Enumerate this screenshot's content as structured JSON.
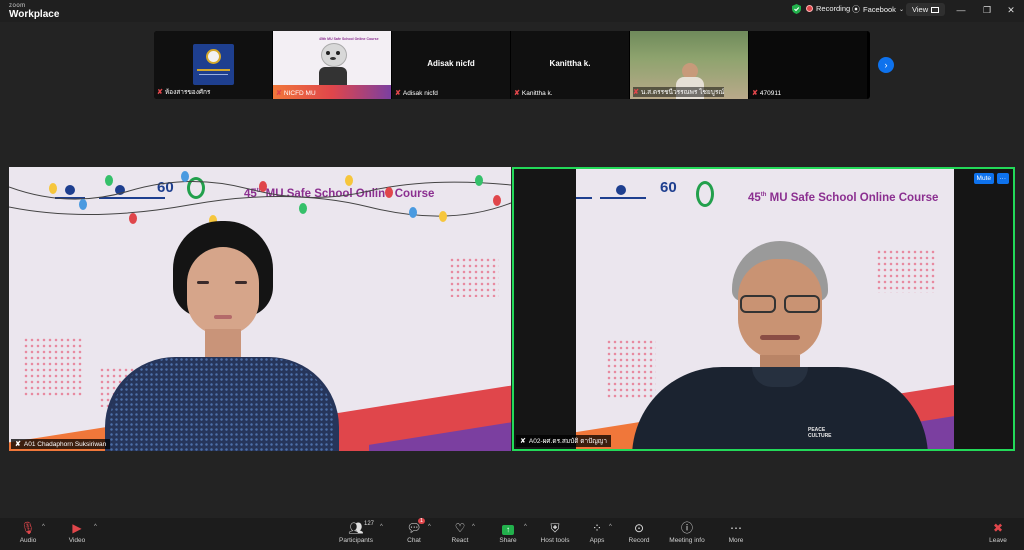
{
  "app": {
    "logo_small": "zoom",
    "logo_big": "Workplace"
  },
  "topbar": {
    "recording_label": "Recording",
    "facebook_label": "Facebook",
    "view_label": "View",
    "colors": {
      "shield": "#22b14c",
      "record_dot": "#e0464b"
    }
  },
  "thumbnails": [
    {
      "name": "ห้องสารของศักร",
      "center_text": ""
    },
    {
      "name": "NICFD MU",
      "center_text": ""
    },
    {
      "name": "Adisak nicfd",
      "center_text": "Adisak nicfd"
    },
    {
      "name": "Kanittha k.",
      "center_text": "Kanittha k."
    },
    {
      "name": "น.ส.ดรรชนีวรรณพร ไชยบูรณ์",
      "center_text": ""
    },
    {
      "name": "470911",
      "center_text": ""
    }
  ],
  "thumb_slide_title": "45th MU Safe School Online Course",
  "tiles": {
    "left": {
      "name": "A01 Chadaphorn Suksiriwan",
      "title_main": "45",
      "title_sup": "th",
      "title_rest": " MU Safe School Online Course"
    },
    "right": {
      "name": "A02-ผศ.ดร.สมบัติ ตาปัญญา",
      "title_main": "45",
      "title_sup": "th",
      "title_rest": " MU Safe School Online Course",
      "mute_label": "Mute",
      "more_label": "···",
      "shirt_text": "PEACE CULTURE",
      "active_border": "#23d959"
    }
  },
  "toolbar": {
    "audio": "Audio",
    "video": "Video",
    "participants": "Participants",
    "participants_count": "127",
    "chat": "Chat",
    "chat_badge": "1",
    "react": "React",
    "share": "Share",
    "host_tools": "Host tools",
    "apps": "Apps",
    "record": "Record",
    "meeting_info": "Meeting info",
    "more": "More",
    "leave": "Leave",
    "share_color": "#22b14c",
    "leave_color": "#e0464b"
  },
  "slide_colors": {
    "bg": "#ebe6ee",
    "title": "#8b2f90",
    "stripe_orange": "#f0773a",
    "stripe_red": "#e0464b",
    "stripe_purple": "#7b3fa0"
  }
}
